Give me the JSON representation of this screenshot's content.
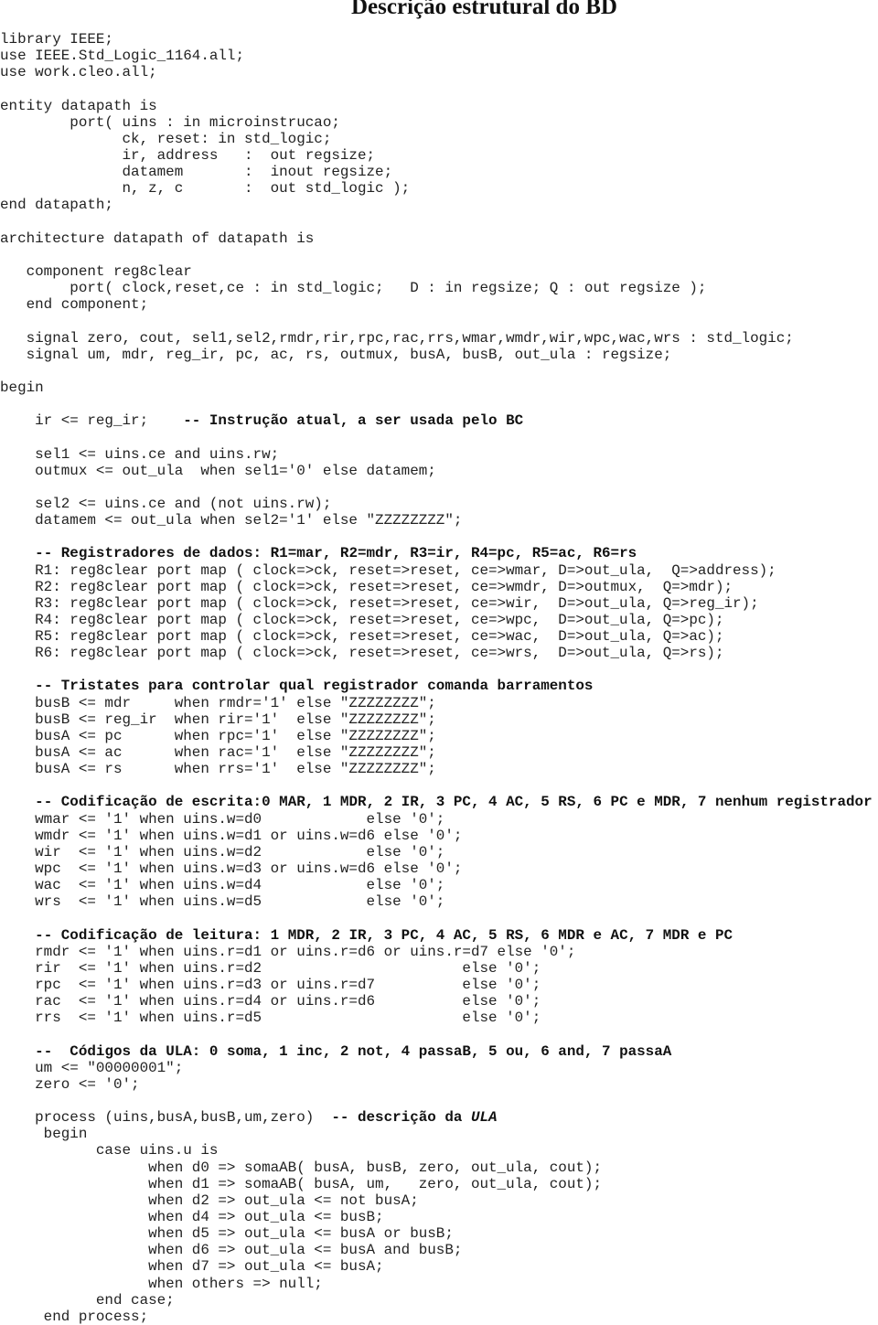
{
  "title": "Descrição estrutural do BD",
  "lines": [
    {
      "t": "library IEEE;"
    },
    {
      "t": "use IEEE.Std_Logic_1164.all;"
    },
    {
      "t": "use work.cleo.all;"
    },
    {
      "t": ""
    },
    {
      "t": "entity datapath is"
    },
    {
      "t": "        port( uins : in microinstrucao;"
    },
    {
      "t": "              ck, reset: in std_logic;"
    },
    {
      "t": "              ir, address   :  out regsize;"
    },
    {
      "t": "              datamem       :  inout regsize;"
    },
    {
      "t": "              n, z, c       :  out std_logic );"
    },
    {
      "t": "end datapath;"
    },
    {
      "t": ""
    },
    {
      "t": "architecture datapath of datapath is"
    },
    {
      "t": ""
    },
    {
      "t": "   component reg8clear"
    },
    {
      "t": "        port( clock,reset,ce : in std_logic;   D : in regsize; Q : out regsize );"
    },
    {
      "t": "   end component;"
    },
    {
      "t": ""
    },
    {
      "t": "   signal zero, cout, sel1,sel2,rmdr,rir,rpc,rac,rrs,wmar,wmdr,wir,wpc,wac,wrs : std_logic;"
    },
    {
      "t": "   signal um, mdr, reg_ir, pc, ac, rs, outmux, busA, busB, out_ula : regsize;"
    },
    {
      "t": ""
    },
    {
      "t": "begin"
    },
    {
      "t": ""
    },
    {
      "t": "    ir <= reg_ir;    ",
      "c": "-- Instrução atual, a ser usada pelo BC"
    },
    {
      "t": ""
    },
    {
      "t": "    sel1 <= uins.ce and uins.rw;"
    },
    {
      "t": "    outmux <= out_ula  when sel1='0' else datamem;"
    },
    {
      "t": ""
    },
    {
      "t": "    sel2 <= uins.ce and (not uins.rw);"
    },
    {
      "t": "    datamem <= out_ula when sel2='1' else \"ZZZZZZZZ\";"
    },
    {
      "t": ""
    },
    {
      "t": "    ",
      "c": "-- Registradores de dados: R1=mar, R2=mdr, R3=ir, R4=pc, R5=ac, R6=rs"
    },
    {
      "t": "    R1: reg8clear port map ( clock=>ck, reset=>reset, ce=>wmar, D=>out_ula,  Q=>address);"
    },
    {
      "t": "    R2: reg8clear port map ( clock=>ck, reset=>reset, ce=>wmdr, D=>outmux,  Q=>mdr);"
    },
    {
      "t": "    R3: reg8clear port map ( clock=>ck, reset=>reset, ce=>wir,  D=>out_ula, Q=>reg_ir);"
    },
    {
      "t": "    R4: reg8clear port map ( clock=>ck, reset=>reset, ce=>wpc,  D=>out_ula, Q=>pc);"
    },
    {
      "t": "    R5: reg8clear port map ( clock=>ck, reset=>reset, ce=>wac,  D=>out_ula, Q=>ac);"
    },
    {
      "t": "    R6: reg8clear port map ( clock=>ck, reset=>reset, ce=>wrs,  D=>out_ula, Q=>rs);"
    },
    {
      "t": ""
    },
    {
      "t": "    ",
      "c": "-- Tristates para controlar qual registrador comanda barramentos"
    },
    {
      "t": "    busB <= mdr     when rmdr='1' else \"ZZZZZZZZ\";"
    },
    {
      "t": "    busB <= reg_ir  when rir='1'  else \"ZZZZZZZZ\";"
    },
    {
      "t": "    busA <= pc      when rpc='1'  else \"ZZZZZZZZ\";"
    },
    {
      "t": "    busA <= ac      when rac='1'  else \"ZZZZZZZZ\";"
    },
    {
      "t": "    busA <= rs      when rrs='1'  else \"ZZZZZZZZ\";"
    },
    {
      "t": ""
    },
    {
      "t": "    ",
      "c": "-- Codificação de escrita:0 MAR, 1 MDR, 2 IR, 3 PC, 4 AC, 5 RS, 6 PC e MDR, 7 nenhum registrador"
    },
    {
      "t": "    wmar <= '1' when uins.w=d0            else '0';"
    },
    {
      "t": "    wmdr <= '1' when uins.w=d1 or uins.w=d6 else '0';"
    },
    {
      "t": "    wir  <= '1' when uins.w=d2            else '0';"
    },
    {
      "t": "    wpc  <= '1' when uins.w=d3 or uins.w=d6 else '0';"
    },
    {
      "t": "    wac  <= '1' when uins.w=d4            else '0';"
    },
    {
      "t": "    wrs  <= '1' when uins.w=d5            else '0';"
    },
    {
      "t": ""
    },
    {
      "t": "    ",
      "c": "-- Codificação de leitura: 1 MDR, 2 IR, 3 PC, 4 AC, 5 RS, 6 MDR e AC, 7 MDR e PC"
    },
    {
      "t": "    rmdr <= '1' when uins.r=d1 or uins.r=d6 or uins.r=d7 else '0';"
    },
    {
      "t": "    rir  <= '1' when uins.r=d2                       else '0';"
    },
    {
      "t": "    rpc  <= '1' when uins.r=d3 or uins.r=d7          else '0';"
    },
    {
      "t": "    rac  <= '1' when uins.r=d4 or uins.r=d6          else '0';"
    },
    {
      "t": "    rrs  <= '1' when uins.r=d5                       else '0';"
    },
    {
      "t": ""
    },
    {
      "t": "    ",
      "c": "--  Códigos da ULA: 0 soma, 1 inc, 2 not, 4 passaB, 5 ou, 6 and, 7 passaA"
    },
    {
      "t": "    um <= \"00000001\";"
    },
    {
      "t": "    zero <= '0';"
    },
    {
      "t": ""
    },
    {
      "t": "    process (uins,busA,busB,um,zero)  ",
      "c": "-- descrição da ",
      "ci": "ULA"
    },
    {
      "t": "     begin"
    },
    {
      "t": "           case uins.u is"
    },
    {
      "t": "                 when d0 => somaAB( busA, busB, zero, out_ula, cout);"
    },
    {
      "t": "                 when d1 => somaAB( busA, um,   zero, out_ula, cout);"
    },
    {
      "t": "                 when d2 => out_ula <= not busA;"
    },
    {
      "t": "                 when d4 => out_ula <= busB;"
    },
    {
      "t": "                 when d5 => out_ula <= busA or busB;"
    },
    {
      "t": "                 when d6 => out_ula <= busA and busB;"
    },
    {
      "t": "                 when d7 => out_ula <= busA;"
    },
    {
      "t": "                 when others => null;"
    },
    {
      "t": "           end case;"
    },
    {
      "t": "     end process;"
    }
  ]
}
